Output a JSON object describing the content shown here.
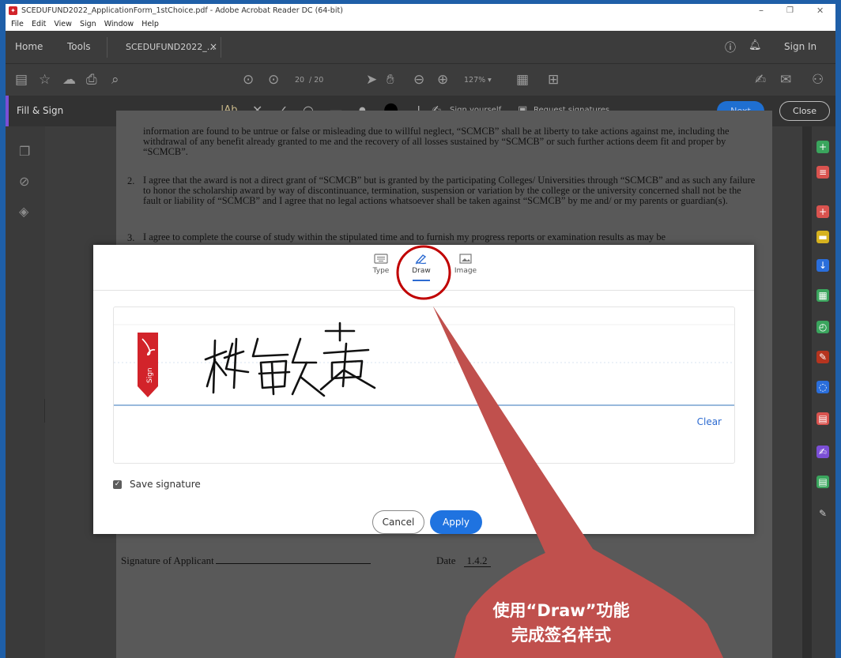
{
  "window": {
    "title": "SCEDUFUND2022_ApplicationForm_1stChoice.pdf - Adobe Acrobat Reader DC (64-bit)",
    "controls": {
      "minimize": "–",
      "restore": "❐",
      "close": "✕"
    }
  },
  "menu": [
    "File",
    "Edit",
    "View",
    "Sign",
    "Window",
    "Help"
  ],
  "tabs": {
    "home": "Home",
    "tools": "Tools",
    "doc": "SCEDUFUND2022_...",
    "doc_close": "×",
    "sign_in": "Sign In"
  },
  "toolbar": {
    "page_current": "20",
    "page_total": "/ 20",
    "zoom": "127%"
  },
  "fill_sign": {
    "label": "Fill & Sign",
    "text_tool": "|Ab",
    "sign_yourself": "Sign yourself",
    "request_signatures": "Request signatures",
    "next": "Next",
    "close": "Close"
  },
  "document": {
    "para1": "information are found to be untrue or false or misleading due to willful neglect, “SCMCB” shall be at liberty to take actions against me, including the withdrawal of any benefit already granted to me and the recovery of all losses sustained by “SCMCB” or such further actions deem fit and proper by “SCMCB”.",
    "item2_num": "2.",
    "item2": "I agree that the award is not a direct grant of “SCMCB” but is granted by the participating Colleges/ Universities through “SCMCB” and as such any failure to honor the scholarship award by way of discontinuance, termination, suspension or variation by the college or the university concerned shall not be the fault or liability of “SCMCB” and I agree that no legal actions whatsoever shall be taken against “SCMCB” by me and/ or my parents or guardian(s).",
    "item3_num": "3.",
    "item3": "I agree to complete the course of study within the stipulated time and to furnish my progress reports or examination results as may be",
    "signature_label": "Signature of Applicant",
    "date_label": "Date",
    "date_value": "1.4.2"
  },
  "dialog": {
    "tabs": {
      "type": "Type",
      "draw": "Draw",
      "image": "Image"
    },
    "sign_tag": "Sign",
    "clear": "Clear",
    "save_signature": "Save signature",
    "cancel": "Cancel",
    "apply": "Apply"
  },
  "annotation": {
    "line1": "使用“Draw”功能",
    "line2": "完成签名样式",
    "color": "#c0504d"
  },
  "colors": {
    "accent_blue": "#1f73e0",
    "acrobat_red": "#d2232a",
    "border_blue": "#1f5fa8"
  }
}
